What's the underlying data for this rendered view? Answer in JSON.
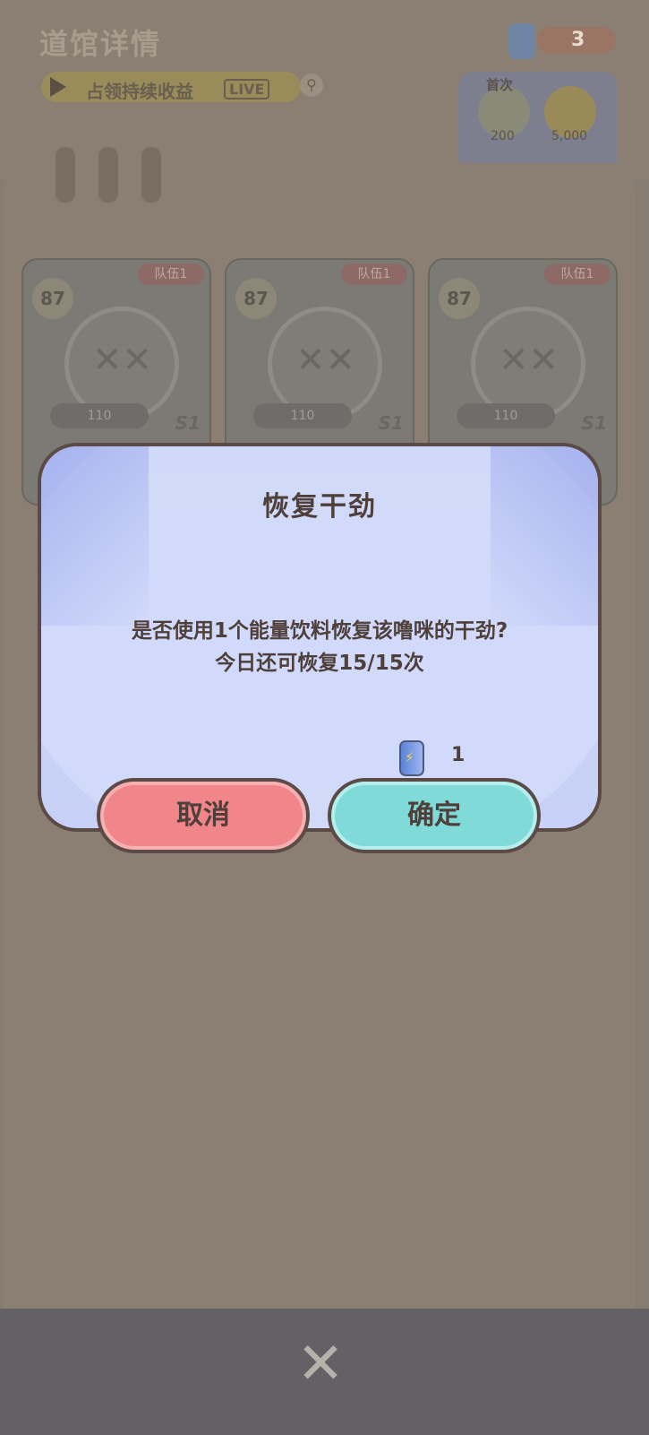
{
  "background": {
    "title": "道馆详情",
    "banner_text": "占领持续收益",
    "banner_logo": "LIVE",
    "currency_count": "3",
    "reward_label": "首次",
    "reward_values": [
      "200",
      "5,000"
    ],
    "cards": [
      {
        "level": "87",
        "team_badge": "队伍1",
        "stat": "110",
        "tag": "S1"
      },
      {
        "level": "87",
        "team_badge": "队伍1",
        "stat": "110",
        "tag": "S1"
      },
      {
        "level": "87",
        "team_badge": "队伍1",
        "stat": "110",
        "tag": "S1"
      }
    ]
  },
  "dialog": {
    "title": "恢复干劲",
    "message_line1": "是否使用1个能量饮料恢复该噜咪的干劲?",
    "message_line2": "今日还可恢复15/15次",
    "cost_icon": "energy-drink-can-icon",
    "cost_amount": "1",
    "cancel_label": "取消",
    "confirm_label": "确定"
  },
  "colors": {
    "dialog_bg": "#c7d0f6",
    "cancel_button": "#f0868a",
    "confirm_button": "#7fdad8",
    "outline": "#5b4a45",
    "text": "#4f3f3a"
  }
}
